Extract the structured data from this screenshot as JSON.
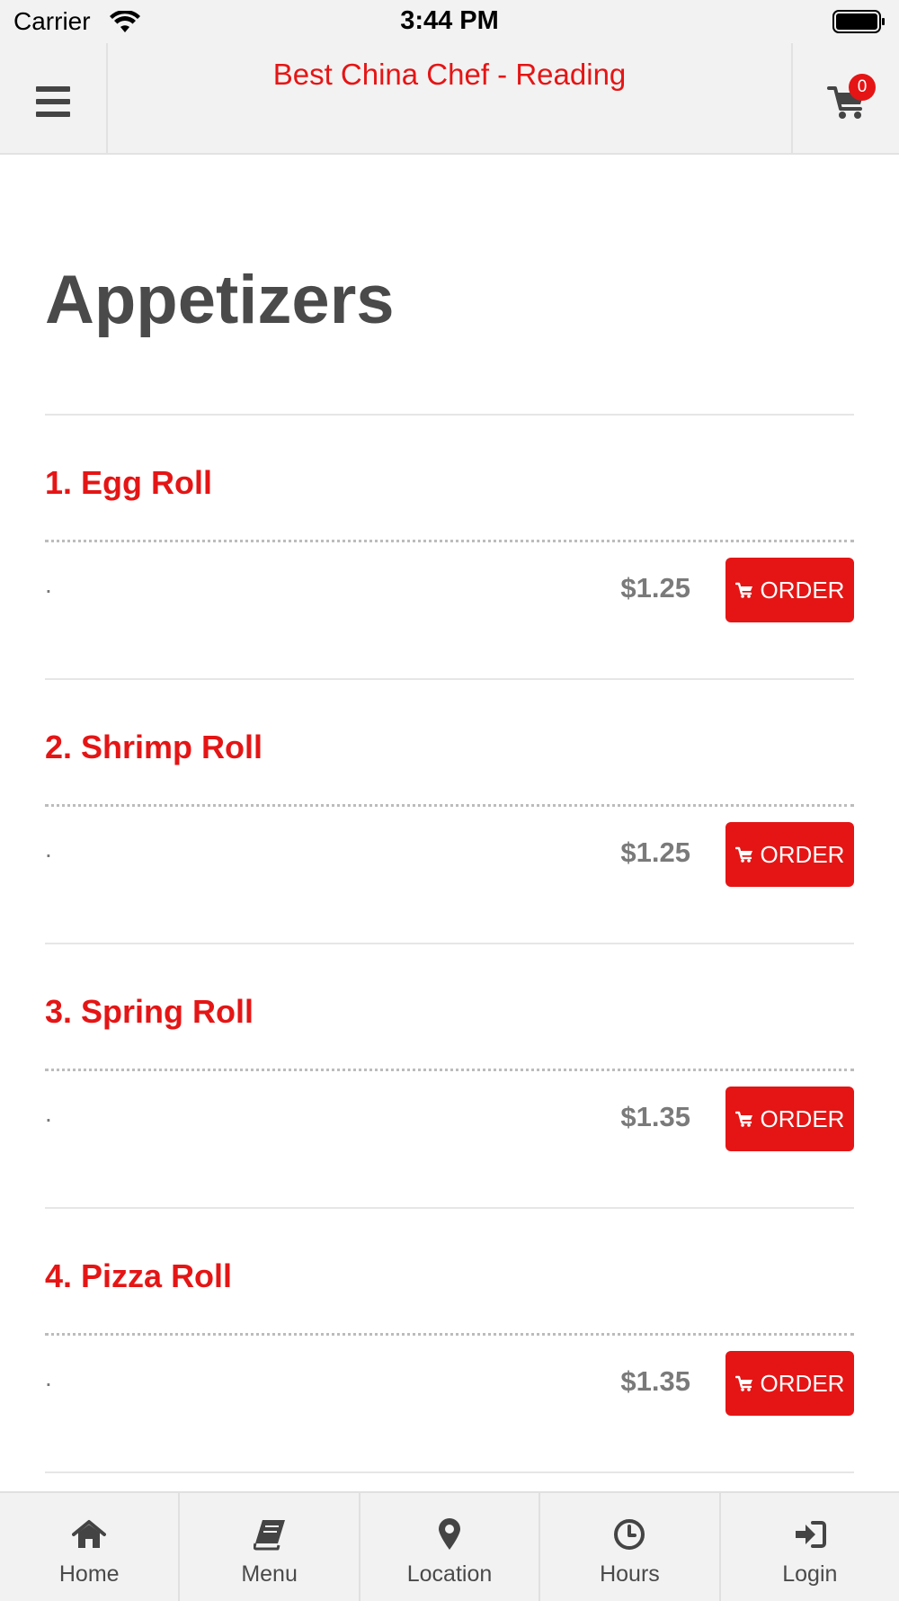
{
  "status_bar": {
    "carrier": "Carrier",
    "time": "3:44 PM"
  },
  "header": {
    "title": "Best China Chef - Reading",
    "cart_count": "0",
    "menu_icon": "hamburger-icon",
    "cart_icon": "shopping-cart-icon"
  },
  "category": {
    "title": "Appetizers"
  },
  "items": [
    {
      "name": "1. Egg Roll",
      "description": ".",
      "price": "$1.25",
      "order_label": "ORDER"
    },
    {
      "name": "2. Shrimp Roll",
      "description": ".",
      "price": "$1.25",
      "order_label": "ORDER"
    },
    {
      "name": "3. Spring Roll",
      "description": ".",
      "price": "$1.35",
      "order_label": "ORDER"
    },
    {
      "name": "4. Pizza Roll",
      "description": ".",
      "price": "$1.35",
      "order_label": "ORDER"
    }
  ],
  "tabs": [
    {
      "label": "Home",
      "icon": "home-icon"
    },
    {
      "label": "Menu",
      "icon": "book-icon"
    },
    {
      "label": "Location",
      "icon": "map-marker-icon"
    },
    {
      "label": "Hours",
      "icon": "clock-icon"
    },
    {
      "label": "Login",
      "icon": "sign-in-icon"
    }
  ],
  "colors": {
    "accent": "#e51515",
    "background": "#ffffff",
    "bar_background": "#f2f2f2",
    "text": "#4a4a4a",
    "price_text": "#7a7a7a"
  }
}
